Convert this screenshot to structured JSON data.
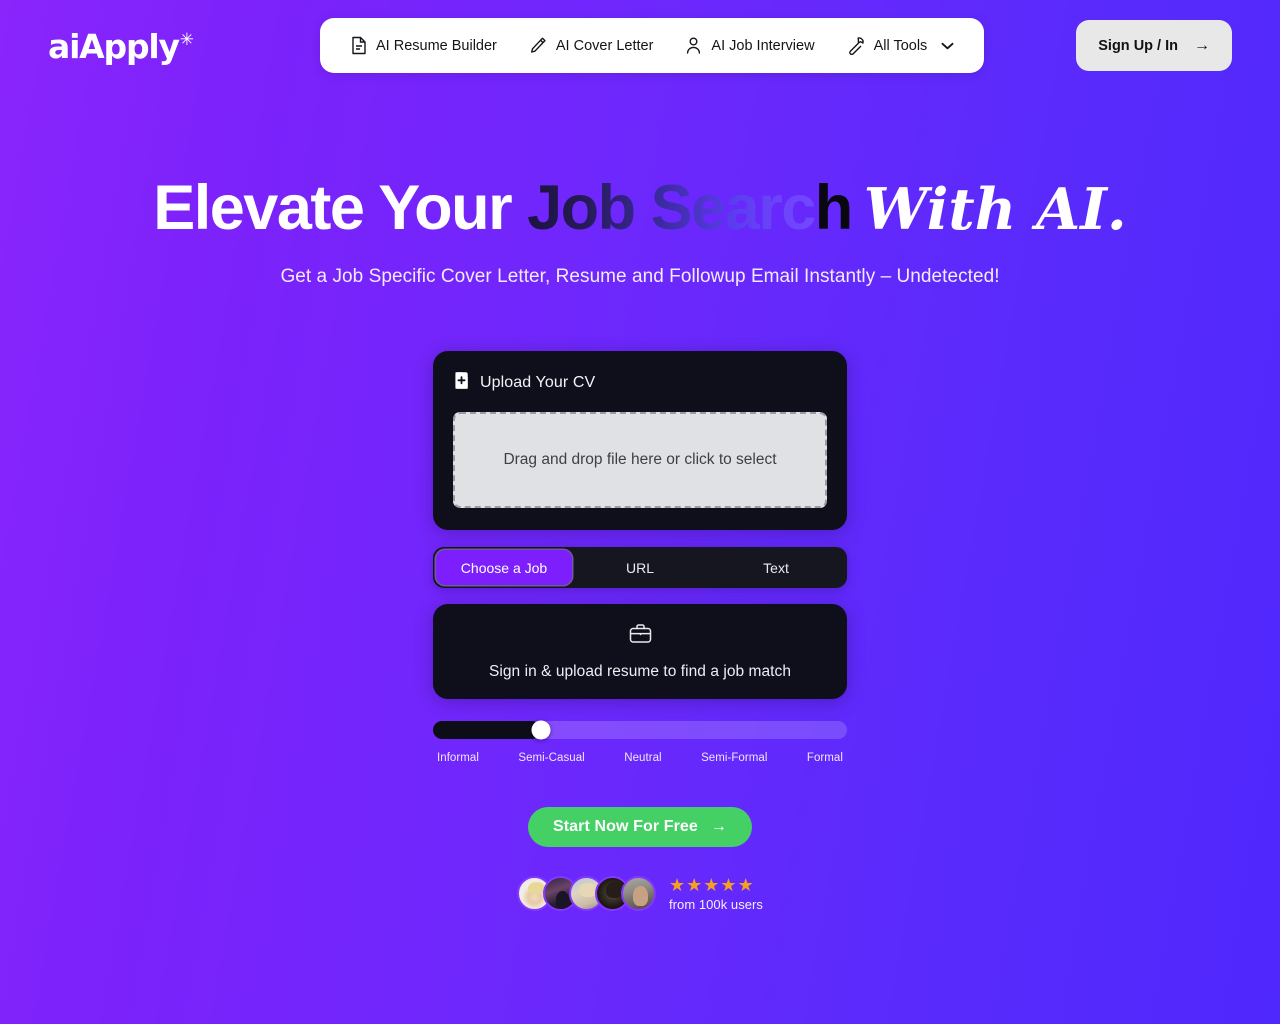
{
  "brand": {
    "name": "aiApply",
    "sparkle": "✳"
  },
  "nav": {
    "items": [
      {
        "label": "AI Resume Builder",
        "icon": "document-icon"
      },
      {
        "label": "AI Cover Letter",
        "icon": "pen-icon"
      },
      {
        "label": "AI Job Interview",
        "icon": "person-icon"
      },
      {
        "label": "All Tools",
        "icon": "wrench-icon",
        "chevron": "chevron-down-icon"
      }
    ],
    "signup_label": "Sign Up / In",
    "signup_arrow": "→"
  },
  "hero": {
    "headline_part1": "Elevate Your ",
    "headline_part2": "Job Searc",
    "headline_part3": "h",
    "headline_part4": "With AI.",
    "subheadline": "Get a Job Specific Cover Letter, Resume and Followup Email Instantly – Undetected!"
  },
  "widget": {
    "upload": {
      "title": "Upload Your CV",
      "icon": "file-plus-icon",
      "dropzone_text": "Drag and drop file here or click to select"
    },
    "tabs": [
      {
        "label": "Choose a Job",
        "active": true
      },
      {
        "label": "URL",
        "active": false
      },
      {
        "label": "Text",
        "active": false
      }
    ],
    "job_match": {
      "icon": "briefcase-icon",
      "text": "Sign in & upload resume to find a job match"
    },
    "tone_slider": {
      "value_percent": 26,
      "labels": [
        "Informal",
        "Semi-Casual",
        "Neutral",
        "Semi-Formal",
        "Formal"
      ]
    },
    "cta": {
      "label": "Start Now For Free",
      "arrow": "→"
    }
  },
  "social_proof": {
    "stars": "★★★★★",
    "rating_text": "from 100k users",
    "avatar_count": 5
  },
  "colors": {
    "bg_left": "#8a25fc",
    "bg_right": "#4f28fd",
    "accent_purple": "#7c1ffc",
    "cta_green": "#45d066",
    "card_dark": "#0e0f1a",
    "star_orange": "#f5a020"
  }
}
